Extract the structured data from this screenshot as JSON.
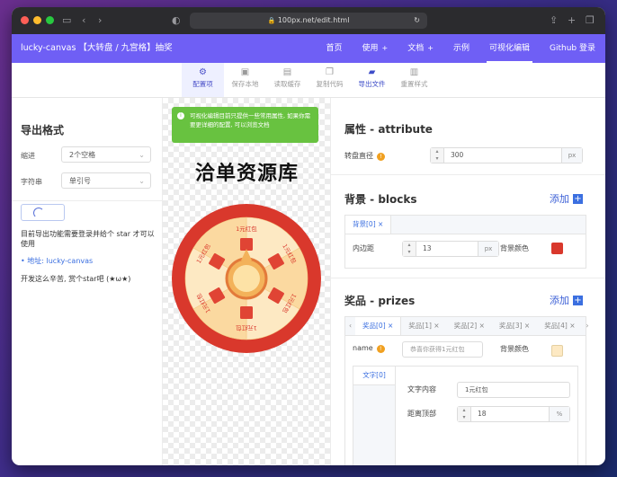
{
  "browser": {
    "url": "100px.net/edit.html",
    "lock": "🔒"
  },
  "nav": {
    "brand": "lucky-canvas 【大转盘 / 九宫格】抽奖",
    "items": [
      {
        "label": "首页",
        "caret": ""
      },
      {
        "label": "使用",
        "caret": "+"
      },
      {
        "label": "文档",
        "caret": "+"
      },
      {
        "label": "示例",
        "caret": ""
      },
      {
        "label": "可视化编辑",
        "caret": ""
      },
      {
        "label": "Github 登录",
        "caret": ""
      }
    ]
  },
  "toolbar": [
    {
      "label": "配置项",
      "icon": "gear-icon"
    },
    {
      "label": "保存本地",
      "icon": "save-icon"
    },
    {
      "label": "读取缓存",
      "icon": "load-icon"
    },
    {
      "label": "复制代码",
      "icon": "copy-icon"
    },
    {
      "label": "导出文件",
      "icon": "folder-icon"
    },
    {
      "label": "重置样式",
      "icon": "trash-icon"
    }
  ],
  "left": {
    "title": "导出格式",
    "indent_label": "缩进",
    "indent_value": "2个空格",
    "string_label": "字符串",
    "string_value": "单引号",
    "login_note": "目前导出功能需要登录并给个 star 才可以使用",
    "addr_label": "地址: lucky-canvas",
    "thanks": "开发这么辛苦, 赏个star吧 (★ω★)"
  },
  "mid": {
    "alert": "可视化编辑目前只提供一些常用属性, 如果你需要更详细的配置, 可以浏览文档",
    "watermark": "洽单资源库",
    "prize_text": "1元红包"
  },
  "right": {
    "attr_title": "属性 - attribute",
    "diameter_label": "转盘直径",
    "diameter_value": "300",
    "unit_px": "px",
    "blocks_title": "背景 - blocks",
    "add_label": "添加",
    "blocks_tab": "背景[0] ×",
    "padding_label": "内边距",
    "padding_value": "13",
    "bgcolor_label": "背景颜色",
    "prizes_title": "奖品 - prizes",
    "prize_tabs": [
      "奖品[0] ×",
      "奖品[1] ×",
      "奖品[2] ×",
      "奖品[3] ×",
      "奖品[4] ×"
    ],
    "name_label": "name",
    "name_placeholder": "恭喜你获得1元红包",
    "prize_bgcolor_label": "背景颜色",
    "font_tab": "文字[0]",
    "text_label": "文字内容",
    "text_value": "1元红包",
    "top_label": "距离顶部",
    "top_value": "18",
    "unit_pct": "%"
  },
  "colors": {
    "accent": "#6f5ff5",
    "block_color": "#d9382c",
    "prize_color": "#fde9c3",
    "alert": "#68c240"
  }
}
